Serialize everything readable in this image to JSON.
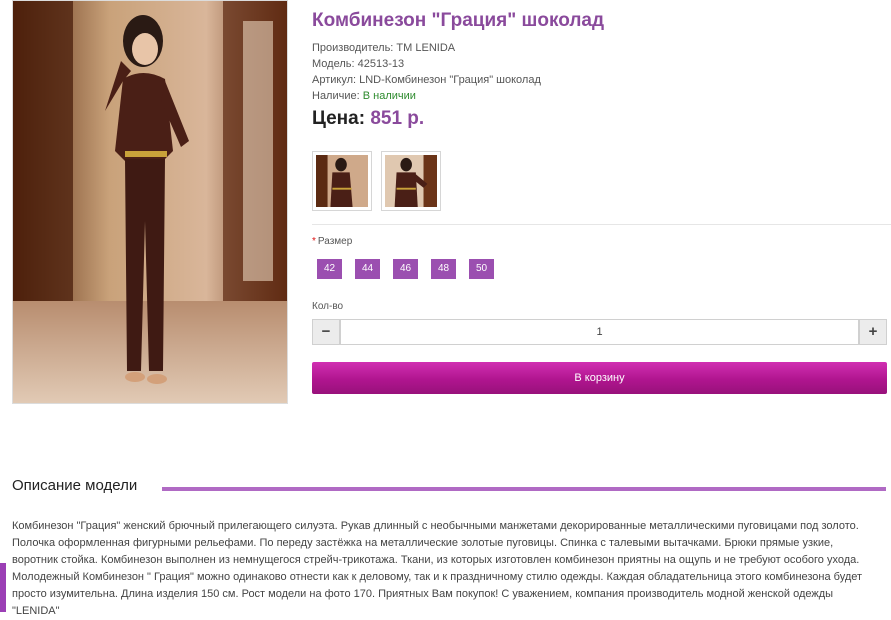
{
  "product": {
    "title": "Комбинезон \"Грация\" шоколад",
    "manufacturer_label": "Производитель: ",
    "manufacturer": "TM LENIDA",
    "model_label": "Модель: ",
    "model": "42513-13",
    "sku_label": "Артикул: ",
    "sku": "LND-Комбинезон \"Грация\" шоколад",
    "availability_label": "Наличие: ",
    "availability": "В наличии",
    "price_label": "Цена: ",
    "price": "851 р."
  },
  "options": {
    "size_label": "Размер",
    "required_mark": "*",
    "sizes": [
      "42",
      "44",
      "46",
      "48",
      "50"
    ]
  },
  "quantity": {
    "label": "Кол-во",
    "value": "1",
    "minus": "−",
    "plus": "+"
  },
  "cart_button": "В корзину",
  "description": {
    "heading": "Описание модели",
    "text": "Комбинезон \"Грация\" женский брючный прилегающего силуэта. Рукав длинный с необычными манжетами декорированные металлическими пуговицами под золото. Полочка оформленная фигурными рельефами. По переду застёжка на металлические золотые пуговицы. Спинка с талевыми вытачками. Брюки прямые узкие, воротник стойка. Комбинезон выполнен из немнущегося стрейч-трикотажа. Ткани, из которых изготовлен комбинезон приятны на ощупь и не требуют особого ухода. Молодежный Комбинезон \" Грация\" можно одинаково отнести как к деловому, так и к праздничному стилю одежды. Каждая обладательница этого комбинезона будет просто изумительна. Длина изделия 150 см. Рост модели на фото 170. Приятных Вам покупок! С уважением, компания производитель модной женской одежды \"LENIDA\""
  },
  "colors": {
    "accent": "#8a4a9c",
    "size_button": "#9b4fb0",
    "cart_button": "#b0158f",
    "in_stock": "#2e8b2e"
  }
}
